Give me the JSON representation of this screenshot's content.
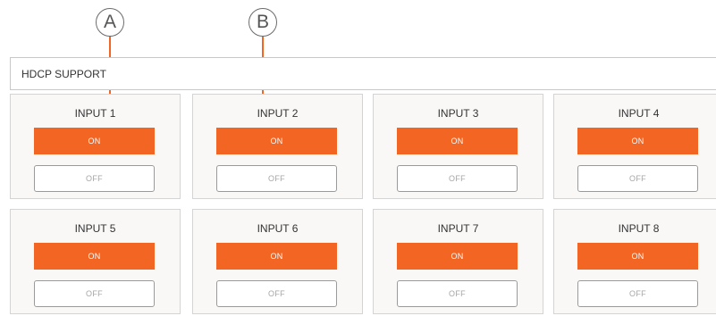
{
  "callouts": [
    "A",
    "B"
  ],
  "section": {
    "title": "HDCP SUPPORT"
  },
  "inputs": [
    {
      "label": "INPUT 1",
      "on": "ON",
      "off": "OFF"
    },
    {
      "label": "INPUT 2",
      "on": "ON",
      "off": "OFF"
    },
    {
      "label": "INPUT 3",
      "on": "ON",
      "off": "OFF"
    },
    {
      "label": "INPUT 4",
      "on": "ON",
      "off": "OFF"
    },
    {
      "label": "INPUT 5",
      "on": "ON",
      "off": "OFF"
    },
    {
      "label": "INPUT 6",
      "on": "ON",
      "off": "OFF"
    },
    {
      "label": "INPUT 7",
      "on": "ON",
      "off": "OFF"
    },
    {
      "label": "INPUT 8",
      "on": "ON",
      "off": "OFF"
    }
  ],
  "colors": {
    "accent": "#f26522",
    "card_bg": "#f9f8f6",
    "border": "#d4d4d4"
  }
}
